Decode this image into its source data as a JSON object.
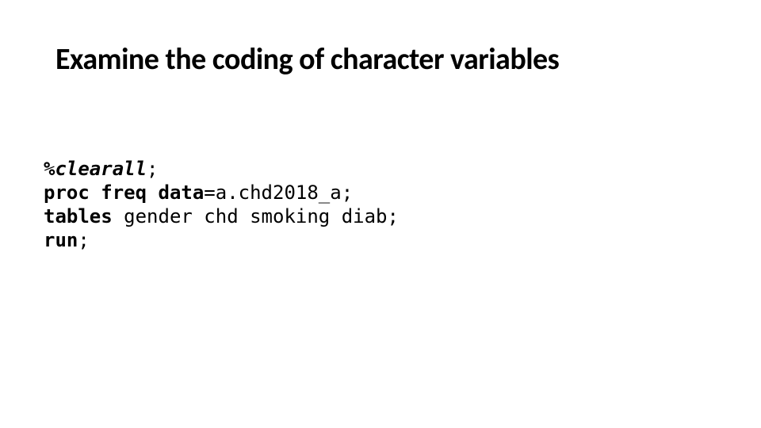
{
  "title": "Examine the coding of character variables",
  "code": {
    "line1": {
      "macro": "%clearall",
      "semi": ";"
    },
    "line2": {
      "proc_freq": "proc freq",
      "space1": " ",
      "data": "data",
      "rest": "=a.chd2018_a;"
    },
    "line3": {
      "tables": "tables",
      "rest": " gender chd smoking diab;"
    },
    "line4": {
      "run": "run",
      "semi": ";"
    }
  }
}
